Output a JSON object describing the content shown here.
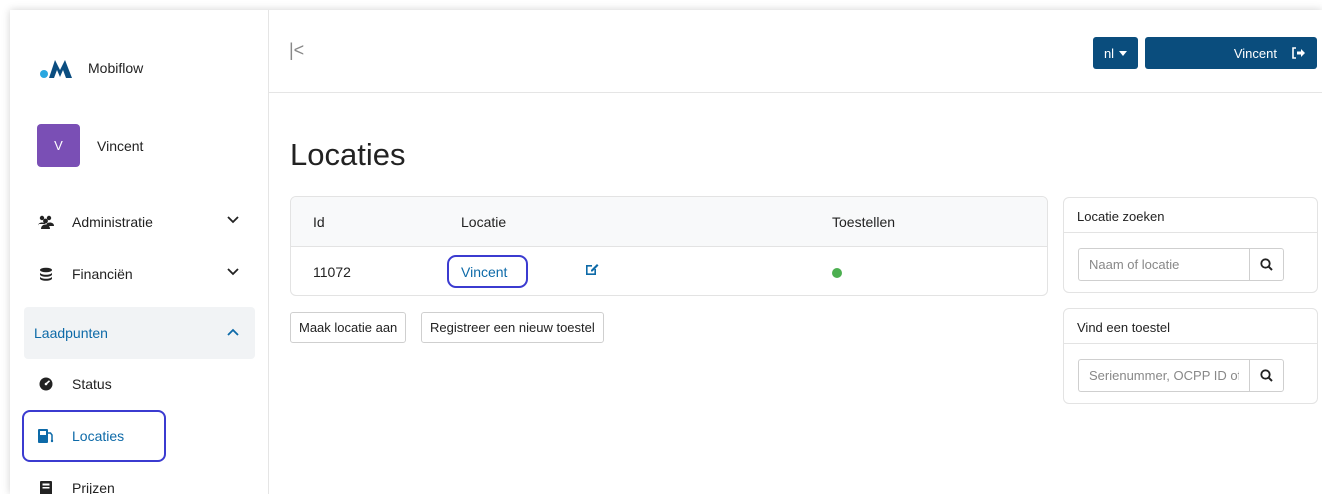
{
  "brand": {
    "name": "Mobiflow",
    "logo_color": "#0b4d80",
    "logo_dot_color": "#2aa7e0"
  },
  "user": {
    "initial": "V",
    "name": "Vincent",
    "avatar_color": "#7a4fb5"
  },
  "sidebar": {
    "items": [
      {
        "label": "Administratie",
        "icon": "users-icon",
        "expanded": false
      },
      {
        "label": "Financiën",
        "icon": "coins-icon",
        "expanded": false
      },
      {
        "label": "Laadpunten",
        "expanded": true
      },
      {
        "label": "Status",
        "icon": "gauge-icon"
      },
      {
        "label": "Locaties",
        "icon": "charging-station-icon",
        "active": true
      },
      {
        "label": "Prijzen",
        "icon": "price-tag-icon"
      }
    ]
  },
  "topbar": {
    "collapse_glyph": "|<",
    "lang_label": "nl",
    "user_label": "Vincent"
  },
  "main": {
    "title": "Locaties",
    "table": {
      "headers": [
        "Id",
        "Locatie",
        "Toestellen"
      ],
      "rows": [
        {
          "id": "11072",
          "location": "Vincent",
          "devices_status": "online",
          "status_color": "#4caf50"
        }
      ]
    },
    "buttons": {
      "create_location": "Maak locatie aan",
      "register_device": "Registreer een nieuw toestel"
    }
  },
  "search_location": {
    "title": "Locatie zoeken",
    "placeholder": "Naam of locatie"
  },
  "find_device": {
    "title": "Vind een toestel",
    "placeholder": "Serienummer, OCPP ID of"
  },
  "colors": {
    "primary": "#0a4d7d",
    "link": "#0d6aa8",
    "highlight": "#3b3bd0"
  }
}
